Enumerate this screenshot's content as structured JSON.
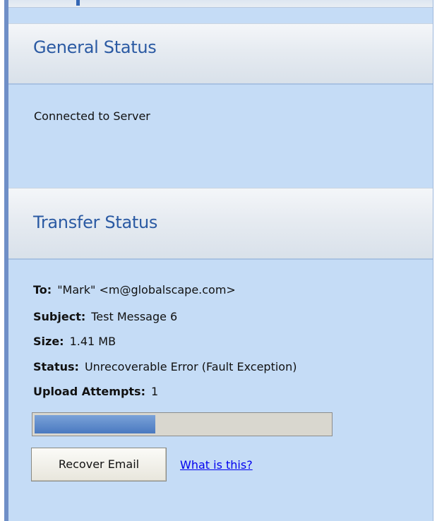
{
  "general": {
    "title": "General Status",
    "status": "Connected to Server"
  },
  "transfer": {
    "title": "Transfer Status",
    "to_label": "To:",
    "to_value": "\"Mark\" <m@globalscape.com>",
    "subject_label": "Subject:",
    "subject_value": "Test Message 6",
    "size_label": "Size:",
    "size_value": "1.41 MB",
    "status_label": "Status:",
    "status_value": "Unrecoverable Error (Fault Exception)",
    "upload_label": "Upload Attempts:",
    "upload_value": "1",
    "progress_fraction": 0.41
  },
  "actions": {
    "recover_label": "Recover Email",
    "help_link": "What is this?"
  },
  "colors": {
    "panel": "#c5dcf6",
    "header_text": "#2b5aa3",
    "progress_fill": "#4a79c0",
    "link": "#0000ee"
  }
}
